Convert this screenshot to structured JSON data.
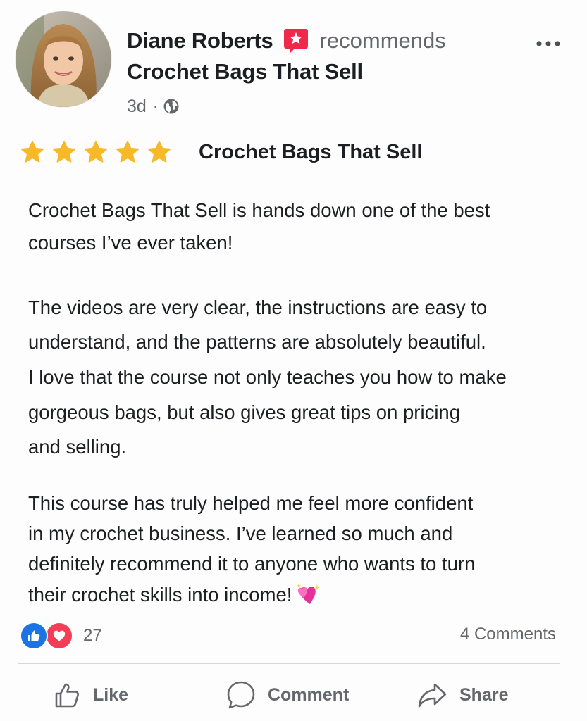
{
  "post": {
    "author_name": "Diane Roberts",
    "verb": "recommends",
    "page_name": "Crochet Bags That Sell",
    "time_ago": "3d",
    "separator": "·",
    "audience_icon": "globe-icon",
    "more_icon": "more-options-icon"
  },
  "rating": {
    "stars": 5,
    "star_color": "#f7b928",
    "title": "Crochet Bags That Sell"
  },
  "body": {
    "lines": [
      "Crochet Bags That Sell is hands down one of the best",
      "courses I’ve ever taken!",
      "The videos are very clear, the instructions are easy to",
      "understand, and the patterns are absolutely beautiful.",
      "I love that the course not only teaches you how to make",
      "gorgeous bags, but also gives great tips on pricing",
      "and selling.",
      "This course has truly helped me feel more confident",
      "in my crochet business. I’ve learned so much and",
      "definitely recommend it to anyone who wants to turn",
      "their crochet skills into income!"
    ],
    "trailing_emoji": "sparkling-hearts-emoji"
  },
  "reactions": {
    "types": [
      "like",
      "love"
    ],
    "count": "27",
    "comments": "4 Comments",
    "like_color": "#1b74e4",
    "love_color": "#f33e58"
  },
  "actions": {
    "like": "Like",
    "comment": "Comment",
    "share": "Share"
  },
  "colors": {
    "recommend_badge": "#f02849",
    "text_primary": "#1c1e21",
    "text_secondary": "#65676b"
  }
}
